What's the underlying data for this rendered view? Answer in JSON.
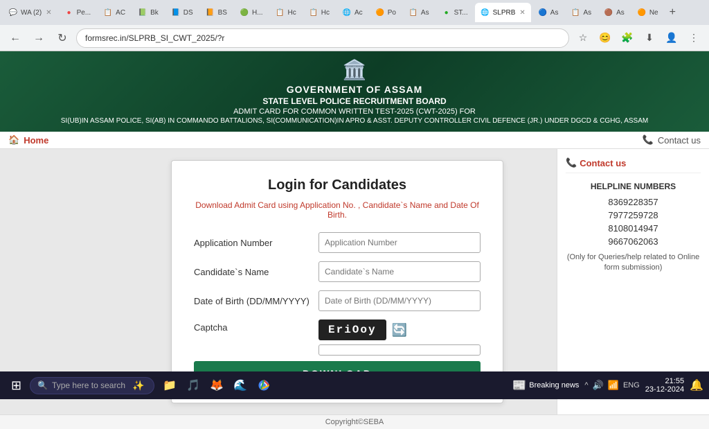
{
  "browser": {
    "address": "formsrec.in/SLPRB_SI_CWT_2025/?r",
    "tabs": [
      {
        "label": "WA (2)",
        "icon": "💬",
        "active": false
      },
      {
        "label": "Pe...",
        "icon": "🔴",
        "active": false
      },
      {
        "label": "AC",
        "icon": "📋",
        "active": false
      },
      {
        "label": "Bk",
        "icon": "📗",
        "active": false
      },
      {
        "label": "DS",
        "icon": "📘",
        "active": false
      },
      {
        "label": "BS",
        "icon": "📙",
        "active": false
      },
      {
        "label": "H...",
        "icon": "🟢",
        "active": false
      },
      {
        "label": "Hc",
        "icon": "📋",
        "active": false
      },
      {
        "label": "Hc",
        "icon": "📋",
        "active": false
      },
      {
        "label": "Ac",
        "icon": "🌐",
        "active": false
      },
      {
        "label": "Po",
        "icon": "🟠",
        "active": false
      },
      {
        "label": "As",
        "icon": "📋",
        "active": false
      },
      {
        "label": "ST...",
        "icon": "🟢",
        "active": false
      },
      {
        "label": "SLPRB",
        "icon": "🌐",
        "active": true
      },
      {
        "label": "As",
        "icon": "🔵",
        "active": false
      },
      {
        "label": "As",
        "icon": "📋",
        "active": false
      },
      {
        "label": "As",
        "icon": "🟤",
        "active": false
      },
      {
        "label": "Ne",
        "icon": "🟠",
        "active": false
      }
    ]
  },
  "header": {
    "emblem": "🏛️",
    "line1": "GOVERNMENT OF ASSAM",
    "line2": "STATE LEVEL POLICE RECRUITMENT BOARD",
    "line3": "ADMIT CARD FOR COMMON WRITTEN TEST-2025 (CWT-2025) FOR",
    "line4": "SI(UB)IN ASSAM POLICE, SI(AB) IN COMMANDO BATTALIONS, SI(COMMUNICATION)IN APRO & ASST. DEPUTY CONTROLLER CIVIL DEFENCE (JR.) UNDER DGCD & CGHG, ASSAM"
  },
  "nav": {
    "home_label": "Home",
    "contact_label": "Contact us"
  },
  "form": {
    "title": "Login for Candidates",
    "subtitle": "Download Admit Card using Application No. , Candidate`s Name and Date Of Birth.",
    "app_number_label": "Application Number",
    "app_number_placeholder": "Application Number",
    "candidate_name_label": "Candidate`s Name",
    "candidate_name_placeholder": "Candidate`s Name",
    "dob_label": "Date of Birth (DD/MM/YYYY)",
    "dob_placeholder": "Date of Birth (DD/MM/YYYY)",
    "captcha_label": "Captcha",
    "captcha_text": "EriOoy",
    "download_label": "DOWNLOAD"
  },
  "sidebar": {
    "contact_header": "Contact us",
    "helpline_title": "HELPLINE NUMBERS",
    "numbers": [
      "8369228357",
      "7977259728",
      "8108014947",
      "9667062063"
    ],
    "note": "(Only for Queries/help related to Online form submission)"
  },
  "footer": {
    "copyright": "Copyright©SEBA"
  },
  "taskbar": {
    "search_placeholder": "Type here to search",
    "news_label": "Breaking news",
    "time": "21:55",
    "date": "23-12-2024",
    "lang": "ENG"
  }
}
